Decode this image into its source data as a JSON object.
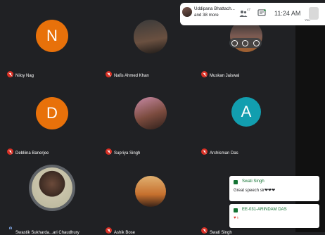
{
  "topbar": {
    "presenter_text_line1": "Uddipana Bhattach...",
    "presenter_text_line2": "and 38 more",
    "participants_badge": "47",
    "time": "11:24 AM",
    "self_label": "You",
    "people_icon": "people-icon",
    "chat_icon": "chat-icon"
  },
  "tiles": [
    {
      "name": "Niloy Nag",
      "initial": "N",
      "color": "#e8710a",
      "type": "initial"
    },
    {
      "name": "Nafis Ahmed Khan",
      "type": "photo",
      "photo": "p4"
    },
    {
      "name": "Muskan Jaiswal",
      "type": "photo",
      "photo": "p5"
    },
    {
      "name": "Debliina Banerjee",
      "initial": "D",
      "color": "#e8710a",
      "type": "initial"
    },
    {
      "name": "Supriya Singh",
      "type": "photo",
      "photo": "p2"
    },
    {
      "name": "Archisman Das",
      "initial": "A",
      "color": "#129eaf",
      "type": "initial"
    },
    {
      "name": "Swastik Sukharda...ari Chaudhury",
      "type": "photo",
      "photo": "p6"
    },
    {
      "name": "Ashik Bose",
      "type": "photo",
      "photo": "p3"
    },
    {
      "name": "Swati Singh",
      "type": "none"
    }
  ],
  "chat_toasts": [
    {
      "sender": "Swati Singh",
      "message": "Great speech sir❤❤❤"
    },
    {
      "sender": "EE-031-ARINDAM DAS",
      "message": "♥♁"
    }
  ],
  "colors": {
    "background": "#202124",
    "muted_mic": "#d93025",
    "chat_green": "#137333"
  }
}
